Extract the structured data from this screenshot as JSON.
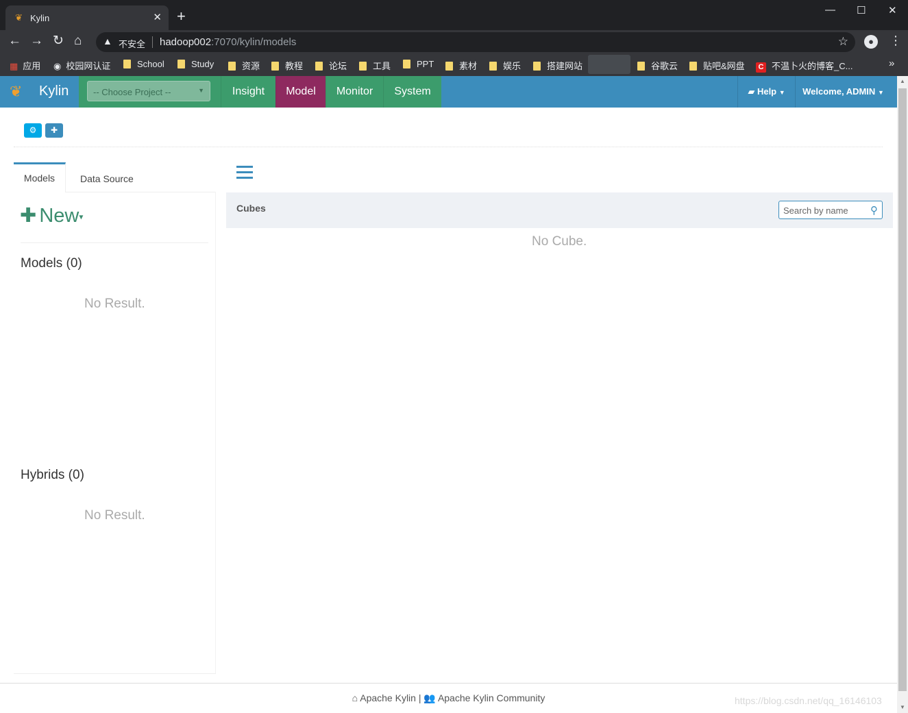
{
  "browser": {
    "tab_title": "Kylin",
    "tab_close": "✕",
    "new_tab": "+",
    "window_controls": {
      "minimize": "—",
      "maximize": "☐",
      "close": "✕"
    },
    "nav": {
      "back": "←",
      "forward": "→",
      "reload": "↻",
      "home": "⌂"
    },
    "address": {
      "insecure_label": "不安全",
      "host": "hadoop002",
      "path": ":7070/kylin/models"
    },
    "bookmarks": [
      {
        "label": "应用",
        "icon": "apps-grid-icon"
      },
      {
        "label": "校园网认证",
        "icon": "globe-icon"
      },
      {
        "label": "School",
        "icon": "folder-icon"
      },
      {
        "label": "Study",
        "icon": "folder-icon"
      },
      {
        "label": "资源",
        "icon": "folder-icon"
      },
      {
        "label": "教程",
        "icon": "folder-icon"
      },
      {
        "label": "论坛",
        "icon": "folder-icon"
      },
      {
        "label": "工具",
        "icon": "folder-icon"
      },
      {
        "label": "PPT",
        "icon": "folder-icon"
      },
      {
        "label": "素材",
        "icon": "folder-icon"
      },
      {
        "label": "娱乐",
        "icon": "folder-icon"
      },
      {
        "label": "搭建网站",
        "icon": "folder-icon"
      },
      {
        "label": "谷歌云",
        "icon": "folder-icon"
      },
      {
        "label": "贴吧&网盘",
        "icon": "folder-icon"
      },
      {
        "label": "不温卜火的博客_C...",
        "icon": "csdn-icon"
      }
    ],
    "bookmarks_overflow": "»"
  },
  "kylin": {
    "brand": "Kylin",
    "project_select": "-- Choose Project --",
    "menu": [
      "Insight",
      "Model",
      "Monitor",
      "System"
    ],
    "active_menu": "Model",
    "help": "Help",
    "welcome": "Welcome, ADMIN",
    "colors": {
      "navbar": "#3c8dbc",
      "menu_green": "#3c9c6c",
      "active": "#8e2a5f"
    }
  },
  "left": {
    "tabs": [
      "Models",
      "Data Source"
    ],
    "new_label": "New",
    "models_title": "Models (0)",
    "models_empty": "No Result.",
    "hybrids_title": "Hybrids (0)",
    "hybrids_empty": "No Result."
  },
  "main": {
    "cubes_label": "Cubes",
    "search_placeholder": "Search by name",
    "empty": "No Cube."
  },
  "footer": {
    "link1": "Apache Kylin",
    "separator": "|",
    "link2": "Apache Kylin Community"
  },
  "watermark": "https://blog.csdn.net/qq_16146103"
}
